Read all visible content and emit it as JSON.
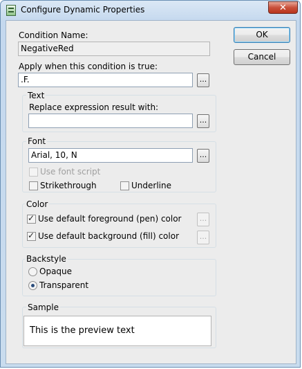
{
  "window": {
    "title": "Configure Dynamic Properties",
    "close_glyph": "✕"
  },
  "condition": {
    "name_label": "Condition Name:",
    "name_value": "NegativeRed",
    "apply_label": "Apply when this condition is true:",
    "apply_value": ".F."
  },
  "ellipsis": "...",
  "text_group": {
    "label": "Text",
    "replace_label": "Replace expression result with:",
    "replace_value": ""
  },
  "font_group": {
    "label": "Font",
    "font_value": "Arial, 10, N",
    "use_font_script": "Use font script",
    "strikethrough": "Strikethrough",
    "underline": "Underline"
  },
  "color_group": {
    "label": "Color",
    "fg": "Use default foreground (pen) color",
    "bg": "Use default background (fill) color"
  },
  "backstyle_group": {
    "label": "Backstyle",
    "opaque": "Opaque",
    "transparent": "Transparent"
  },
  "sample_group": {
    "label": "Sample",
    "preview": "This is the preview text"
  },
  "buttons": {
    "ok": "OK",
    "cancel": "Cancel"
  }
}
